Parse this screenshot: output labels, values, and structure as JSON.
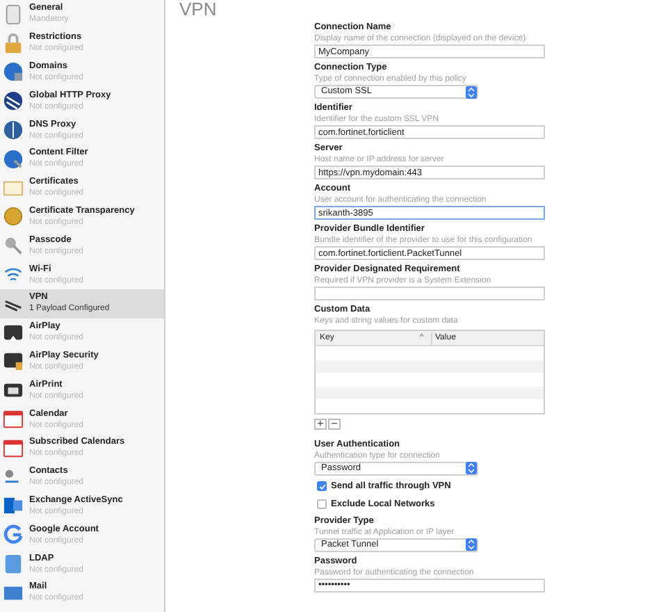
{
  "sidebar": {
    "items": [
      {
        "title": "General",
        "subtitle": "Mandatory",
        "selected": false
      },
      {
        "title": "Restrictions",
        "subtitle": "Not configured",
        "selected": false
      },
      {
        "title": "Domains",
        "subtitle": "Not configured",
        "selected": false
      },
      {
        "title": "Global HTTP Proxy",
        "subtitle": "Not configured",
        "selected": false
      },
      {
        "title": "DNS Proxy",
        "subtitle": "Not configured",
        "selected": false
      },
      {
        "title": "Content Filter",
        "subtitle": "Not configured",
        "selected": false
      },
      {
        "title": "Certificates",
        "subtitle": "Not configured",
        "selected": false
      },
      {
        "title": "Certificate Transparency",
        "subtitle": "Not configured",
        "selected": false
      },
      {
        "title": "Passcode",
        "subtitle": "Not configured",
        "selected": false
      },
      {
        "title": "Wi-Fi",
        "subtitle": "Not configured",
        "selected": false
      },
      {
        "title": "VPN",
        "subtitle": "1 Payload Configured",
        "selected": true
      },
      {
        "title": "AirPlay",
        "subtitle": "Not configured",
        "selected": false
      },
      {
        "title": "AirPlay Security",
        "subtitle": "Not configured",
        "selected": false
      },
      {
        "title": "AirPrint",
        "subtitle": "Not configured",
        "selected": false
      },
      {
        "title": "Calendar",
        "subtitle": "Not configured",
        "selected": false
      },
      {
        "title": "Subscribed Calendars",
        "subtitle": "Not configured",
        "selected": false
      },
      {
        "title": "Contacts",
        "subtitle": "Not configured",
        "selected": false
      },
      {
        "title": "Exchange ActiveSync",
        "subtitle": "Not configured",
        "selected": false
      },
      {
        "title": "Google Account",
        "subtitle": "Not configured",
        "selected": false
      },
      {
        "title": "LDAP",
        "subtitle": "Not configured",
        "selected": false
      },
      {
        "title": "Mail",
        "subtitle": "Not configured",
        "selected": false
      }
    ]
  },
  "pane": {
    "title": "VPN",
    "fields": [
      {
        "kind": "text",
        "label": "Connection Name",
        "description": "Display name of the connection (displayed on the device)",
        "value": "MyCompany",
        "focused": false
      },
      {
        "kind": "select",
        "label": "Connection Type",
        "description": "Type of connection enabled by this policy",
        "value": "Custom SSL"
      },
      {
        "kind": "text",
        "label": "Identifier",
        "description": "Identifier for the custom SSL VPN",
        "value": "com.fortinet.forticlient",
        "focused": false
      },
      {
        "kind": "text",
        "label": "Server",
        "description": "Host name or IP address for server",
        "value": "https://vpn.mydomain:443",
        "focused": false
      },
      {
        "kind": "text",
        "label": "Account",
        "description": "User account for authenticating the connection",
        "value": "srikanth-3895",
        "focused": true
      },
      {
        "kind": "text",
        "label": "Provider Bundle Identifier",
        "description": "Bundle identifier of the provider to use for this configuration",
        "value": "com.fortinet.forticlient.PacketTunnel",
        "focused": false
      },
      {
        "kind": "text",
        "label": "Provider Designated Requirement",
        "description": "Required if VPN provider is a System Extension",
        "focused": false
      },
      {
        "kind": "table",
        "label": "Custom Data",
        "description": "Keys and string values for custom data",
        "columns": [
          "Key",
          "Value"
        ],
        "sort_arrow": "^",
        "add": "+",
        "remove": "−"
      },
      {
        "kind": "select",
        "label": "User Authentication",
        "description": "Authentication type for connection",
        "value": "Password"
      },
      {
        "kind": "checkbox",
        "label": "Send all traffic through VPN",
        "checked": true
      },
      {
        "kind": "checkbox",
        "label": "Exclude Local Networks",
        "checked": false
      },
      {
        "kind": "select",
        "label": "Provider Type",
        "description": "Tunnel traffic at Application or IP layer",
        "value": "Packet Tunnel"
      },
      {
        "kind": "text",
        "label": "Password",
        "description": "Password for authenticating the connection",
        "value": "••••••••••",
        "focused": false
      }
    ]
  }
}
